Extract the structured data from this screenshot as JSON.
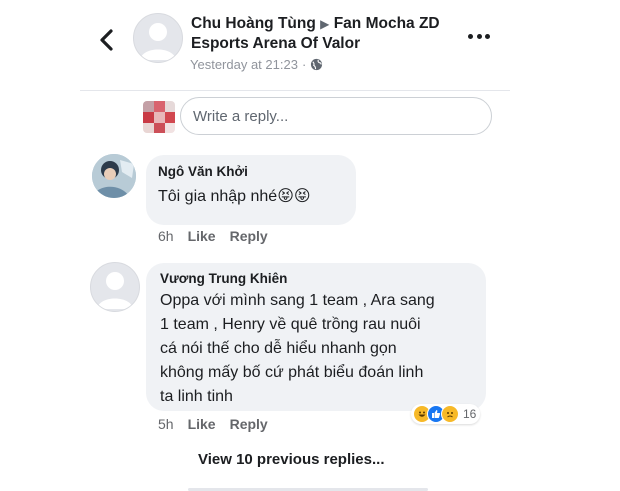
{
  "header": {
    "author": "Chu Hoàng Tùng",
    "separator_icon": "triangle-right-icon",
    "group": "Fan Mocha ZD Esports Arena Of Valor",
    "timestamp": "Yesterday at 21:23",
    "dot": "·",
    "privacy_icon": "globe-icon"
  },
  "reply": {
    "placeholder": "Write a reply..."
  },
  "comments": [
    {
      "name": "Ngô Văn Khởi",
      "text": "Tôi gia nhập nhé",
      "emoji": "😝😝",
      "time": "6h",
      "like": "Like",
      "reply": "Reply"
    },
    {
      "name": "Vương Trung Khiên",
      "lines": [
        "Oppa với mình sang 1 team , Ara sang",
        "1 team , Henry về quê trồng rau nuôi",
        "cá nói thế cho dễ hiểu nhanh gọn",
        "không mấy bố cứ phát biểu đoán linh",
        "ta linh tinh"
      ],
      "time": "5h",
      "like": "Like",
      "reply": "Reply",
      "reactions": [
        "haha",
        "like",
        "sad"
      ],
      "reaction_count": "16"
    }
  ],
  "view_previous": "View 10 previous replies..."
}
